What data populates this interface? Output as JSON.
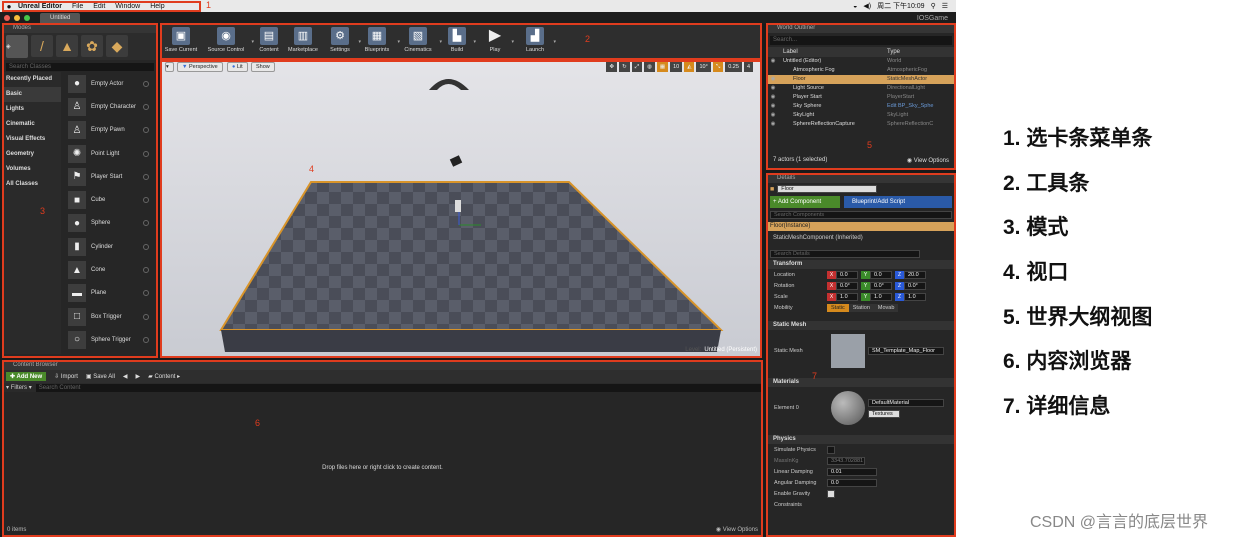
{
  "macbar": {
    "app": "Unreal Editor",
    "menus": [
      "File",
      "Edit",
      "Window",
      "Help"
    ],
    "time": "周二 下午10:09"
  },
  "titlebar": {
    "tab": "Untitled",
    "project": "IOSGame"
  },
  "modes": {
    "title": "Modes",
    "search_placeholder": "Search Classes",
    "categories": [
      "Recently Placed",
      "Basic",
      "Lights",
      "Cinematic",
      "Visual Effects",
      "Geometry",
      "Volumes",
      "All Classes"
    ],
    "actors": [
      "Empty Actor",
      "Empty Character",
      "Empty Pawn",
      "Point Light",
      "Player Start",
      "Cube",
      "Sphere",
      "Cylinder",
      "Cone",
      "Plane",
      "Box Trigger",
      "Sphere Trigger"
    ]
  },
  "toolbar": {
    "buttons": [
      "Save Current",
      "Source Control",
      "Content",
      "Marketplace",
      "Settings",
      "Blueprints",
      "Cinematics",
      "Build",
      "Play",
      "Launch"
    ]
  },
  "viewport": {
    "perspective": "Perspective",
    "lit": "Lit",
    "show": "Show",
    "grid": "10",
    "rot": "10°",
    "scale": "0.25",
    "cams": "4",
    "level_label": "Level:",
    "level_name": "Untitled (Persistent)"
  },
  "outliner": {
    "title": "World Outliner",
    "search_placeholder": "Search...",
    "col_label": "Label",
    "col_type": "Type",
    "rows": [
      {
        "label": "Untitled (Editor)",
        "type": "World"
      },
      {
        "label": "Atmospheric Fog",
        "type": "AtmosphericFog"
      },
      {
        "label": "Floor",
        "type": "StaticMeshActor"
      },
      {
        "label": "Light Source",
        "type": "DirectionalLight"
      },
      {
        "label": "Player Start",
        "type": "PlayerStart"
      },
      {
        "label": "Sky Sphere",
        "type": "Edit BP_Sky_Sphe"
      },
      {
        "label": "SkyLight",
        "type": "SkyLight"
      },
      {
        "label": "SphereReflectionCapture",
        "type": "SphereReflectionC"
      }
    ],
    "footer": "7 actors (1 selected)",
    "view_options": "View Options"
  },
  "content": {
    "title": "Content Browser",
    "add_new": "Add New",
    "import": "Import",
    "save_all": "Save All",
    "path": "Content",
    "filters": "Filters",
    "search_placeholder": "Search Content",
    "drop": "Drop files here or right click to create content.",
    "items": "0 items",
    "view_options": "View Options"
  },
  "details": {
    "title": "Details",
    "name": "Floor",
    "add_component": "+ Add Component",
    "blueprint": "Blueprint/Add Script",
    "search_components": "Search Components",
    "instance": "Floor(Instance)",
    "component": "StaticMeshComponent (Inherited)",
    "search_details": "Search Details",
    "transform": "Transform",
    "location": "Location",
    "rotation": "Rotation",
    "scale": "Scale",
    "mobility": "Mobility",
    "loc": [
      "0.0",
      "0.0",
      "20.0"
    ],
    "rotv": [
      "0.0°",
      "0.0°",
      "0.0°"
    ],
    "scl": [
      "1.0",
      "1.0",
      "1.0"
    ],
    "mob": [
      "Static",
      "Station",
      "Movab"
    ],
    "static_mesh_sec": "Static Mesh",
    "static_mesh_label": "Static Mesh",
    "mesh_value": "SM_Template_Map_Floor",
    "materials": "Materials",
    "element0": "Element 0",
    "material_value": "DefaultMaterial",
    "textures": "Textures",
    "physics": "Physics",
    "simulate": "Simulate Physics",
    "massinkg": "MassInKg",
    "mass_value": "3343.702881",
    "lin_damp": "Linear Damping",
    "lin_val": "0.01",
    "ang_damp": "Angular Damping",
    "ang_val": "0.0",
    "gravity": "Enable Gravity",
    "constraints": "Constraints"
  },
  "annot": [
    "1",
    "2",
    "3",
    "4",
    "5",
    "6",
    "7"
  ],
  "legend": [
    "1.  选卡条菜单条",
    "2.  工具条",
    "3.  模式",
    "4.  视口",
    "5.  世界大纲视图",
    "6.  内容浏览器",
    "7.  详细信息"
  ],
  "watermark": "CSDN @言言的底层世界"
}
